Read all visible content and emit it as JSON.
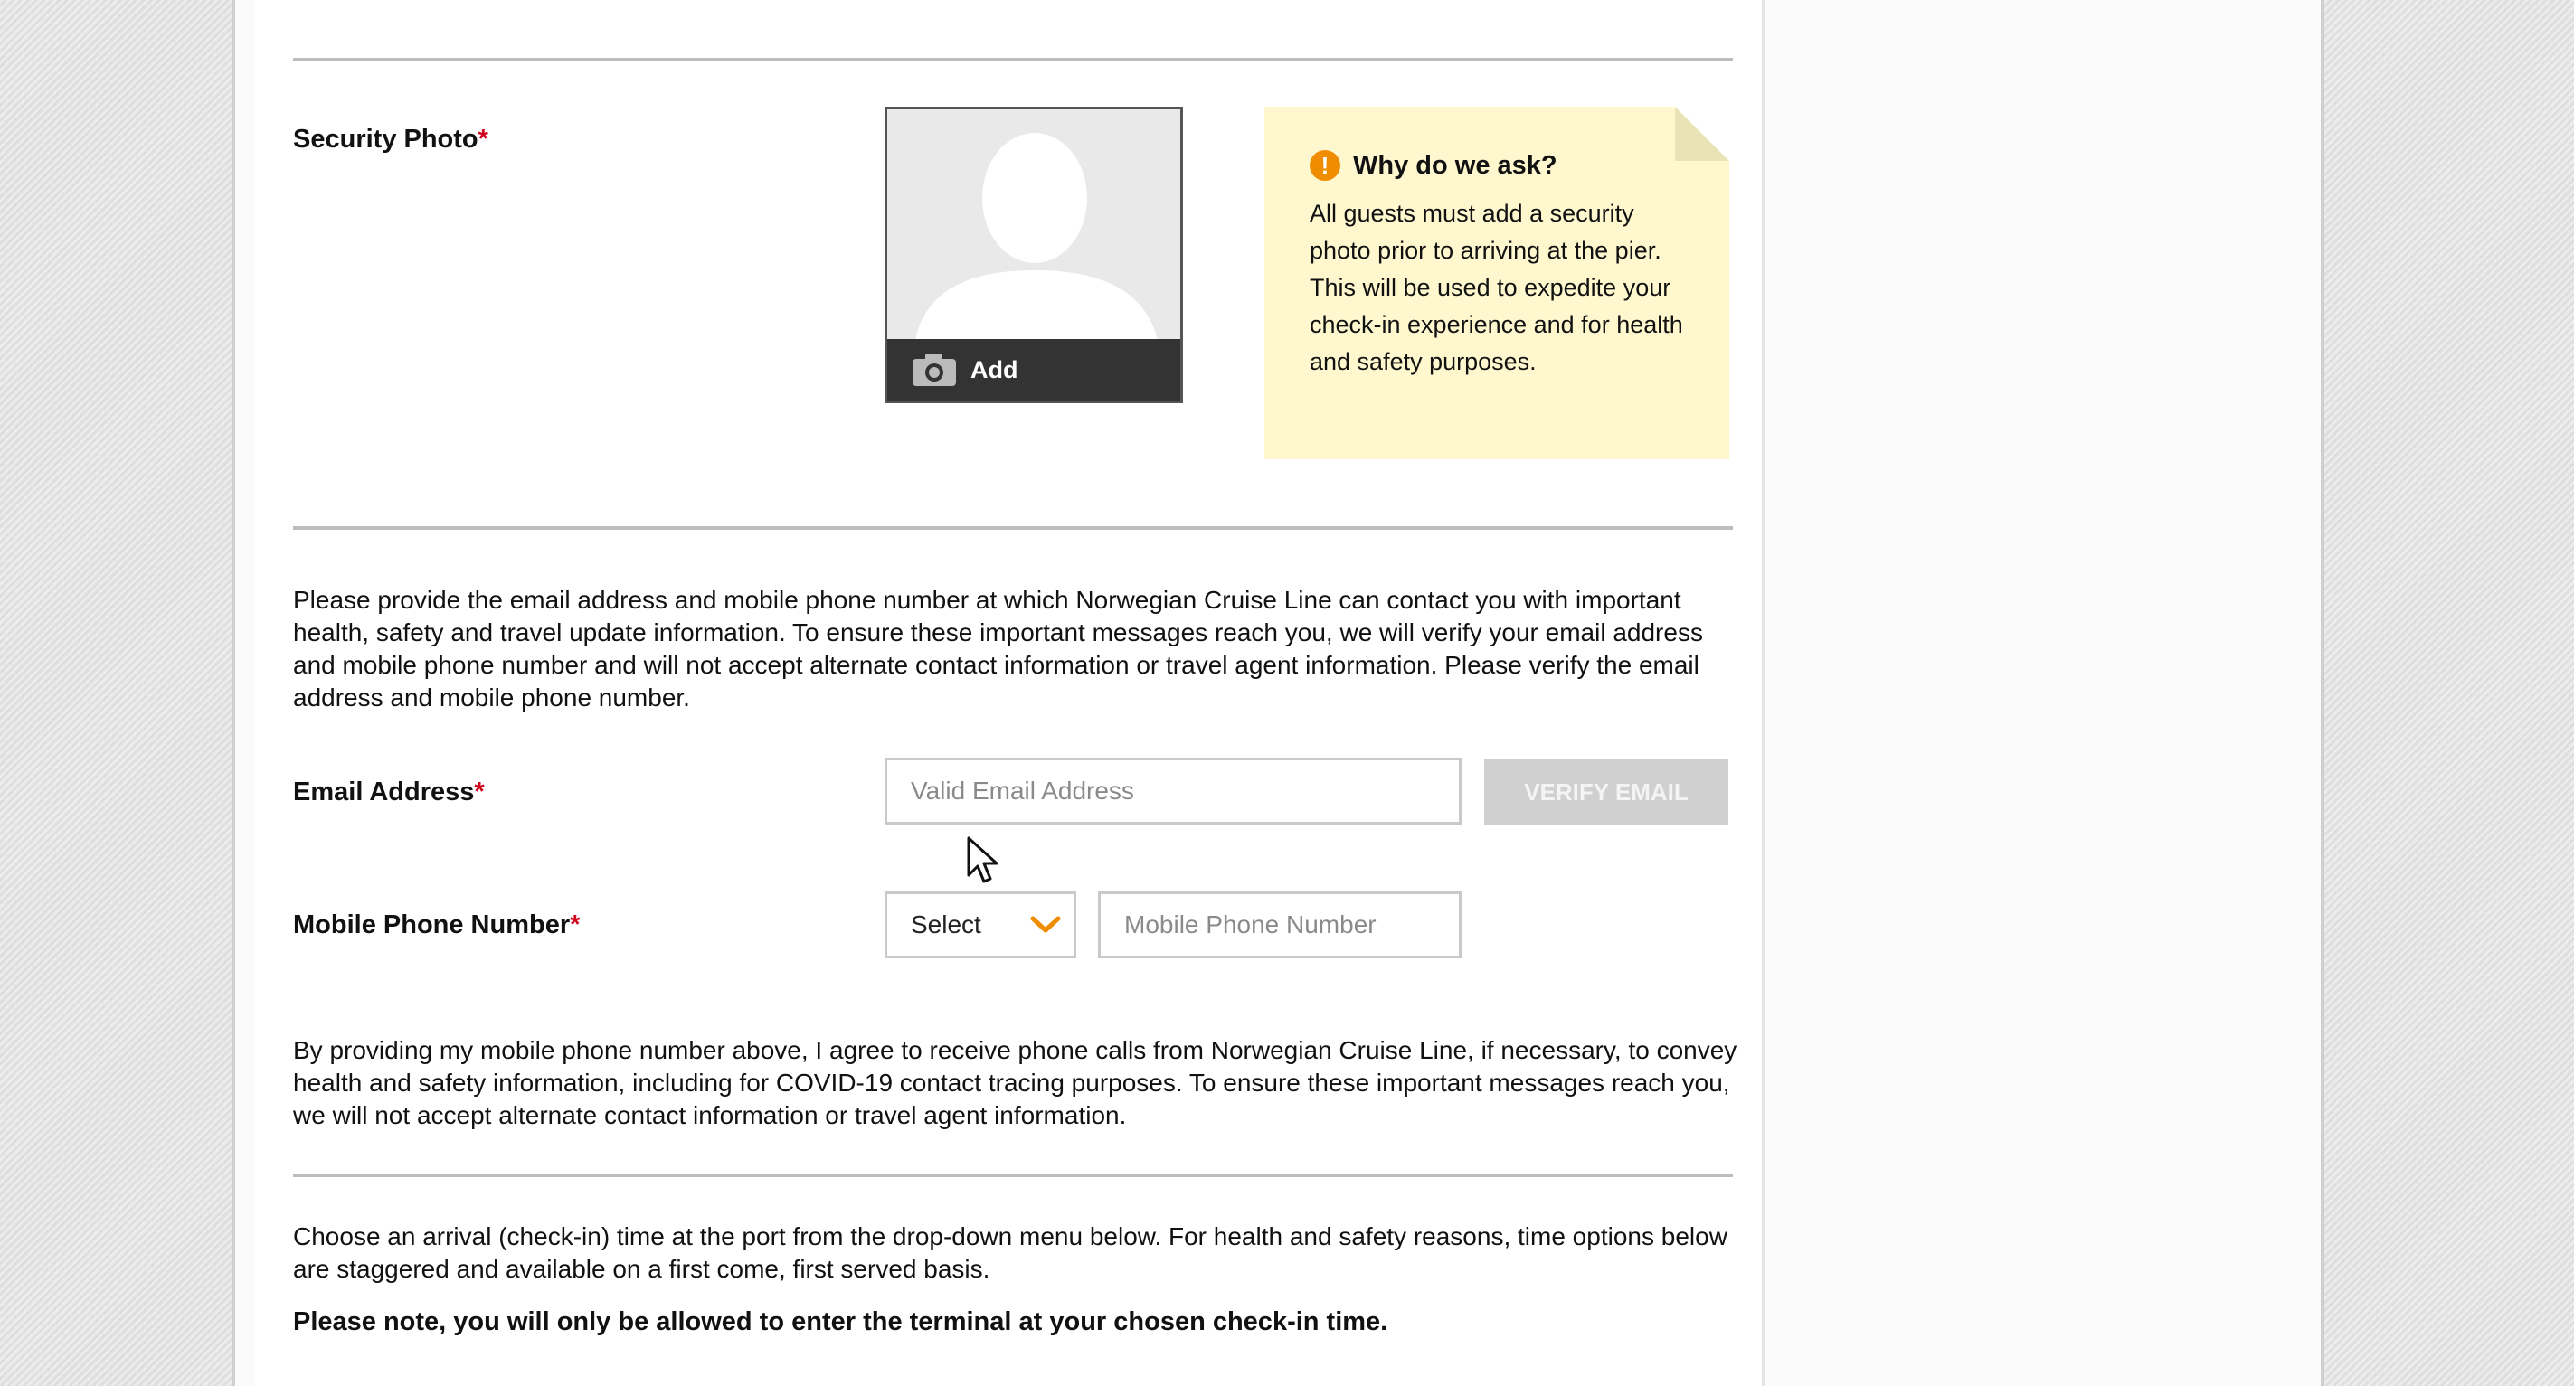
{
  "security_photo": {
    "label": "Security Photo",
    "required_mark": "*",
    "add_label": "Add"
  },
  "why_note": {
    "title": "Why do we ask?",
    "icon": "!",
    "body": "All guests must add a security photo prior to arriving at the pier. This will be used to expedite your check-in experience and for health and safety purposes."
  },
  "contact_intro": "Please provide the email address and mobile phone number at which Norwegian Cruise Line can contact you with important health, safety and travel update information. To ensure these important messages reach you, we will verify your email address and mobile phone number and will not accept alternate contact information or travel agent information. Please verify the email address and mobile phone number.",
  "email": {
    "label": "Email Address",
    "required_mark": "*",
    "value": "",
    "placeholder": "Valid Email Address",
    "verify_label": "VERIFY EMAIL"
  },
  "phone": {
    "label": "Mobile Phone Number",
    "required_mark": "*",
    "country_select": "Select",
    "value": "",
    "placeholder": "Mobile Phone Number"
  },
  "phone_consent": "By providing my mobile phone number above, I agree to receive phone calls from Norwegian Cruise Line, if necessary, to convey health and safety information, including for COVID-19 contact tracing purposes. To ensure these important messages reach you, we will not accept alternate contact information or travel agent information.",
  "arrival": {
    "intro": "Choose an arrival (check-in) time at the port from the drop-down menu below. For health and safety reasons, time options below are staggered and available on a first come, first served basis.",
    "note": "Please note, you will only be allowed to enter the terminal at your chosen check-in time."
  },
  "colors": {
    "required": "#d0021b",
    "accent_chevron": "#f08c00",
    "note_background": "#fff8cf",
    "verify_disabled": "#d0d0d0"
  },
  "icons": [
    "camera-icon",
    "info-icon",
    "chevron-down-icon",
    "mouse-cursor-icon",
    "silhouette-placeholder"
  ]
}
